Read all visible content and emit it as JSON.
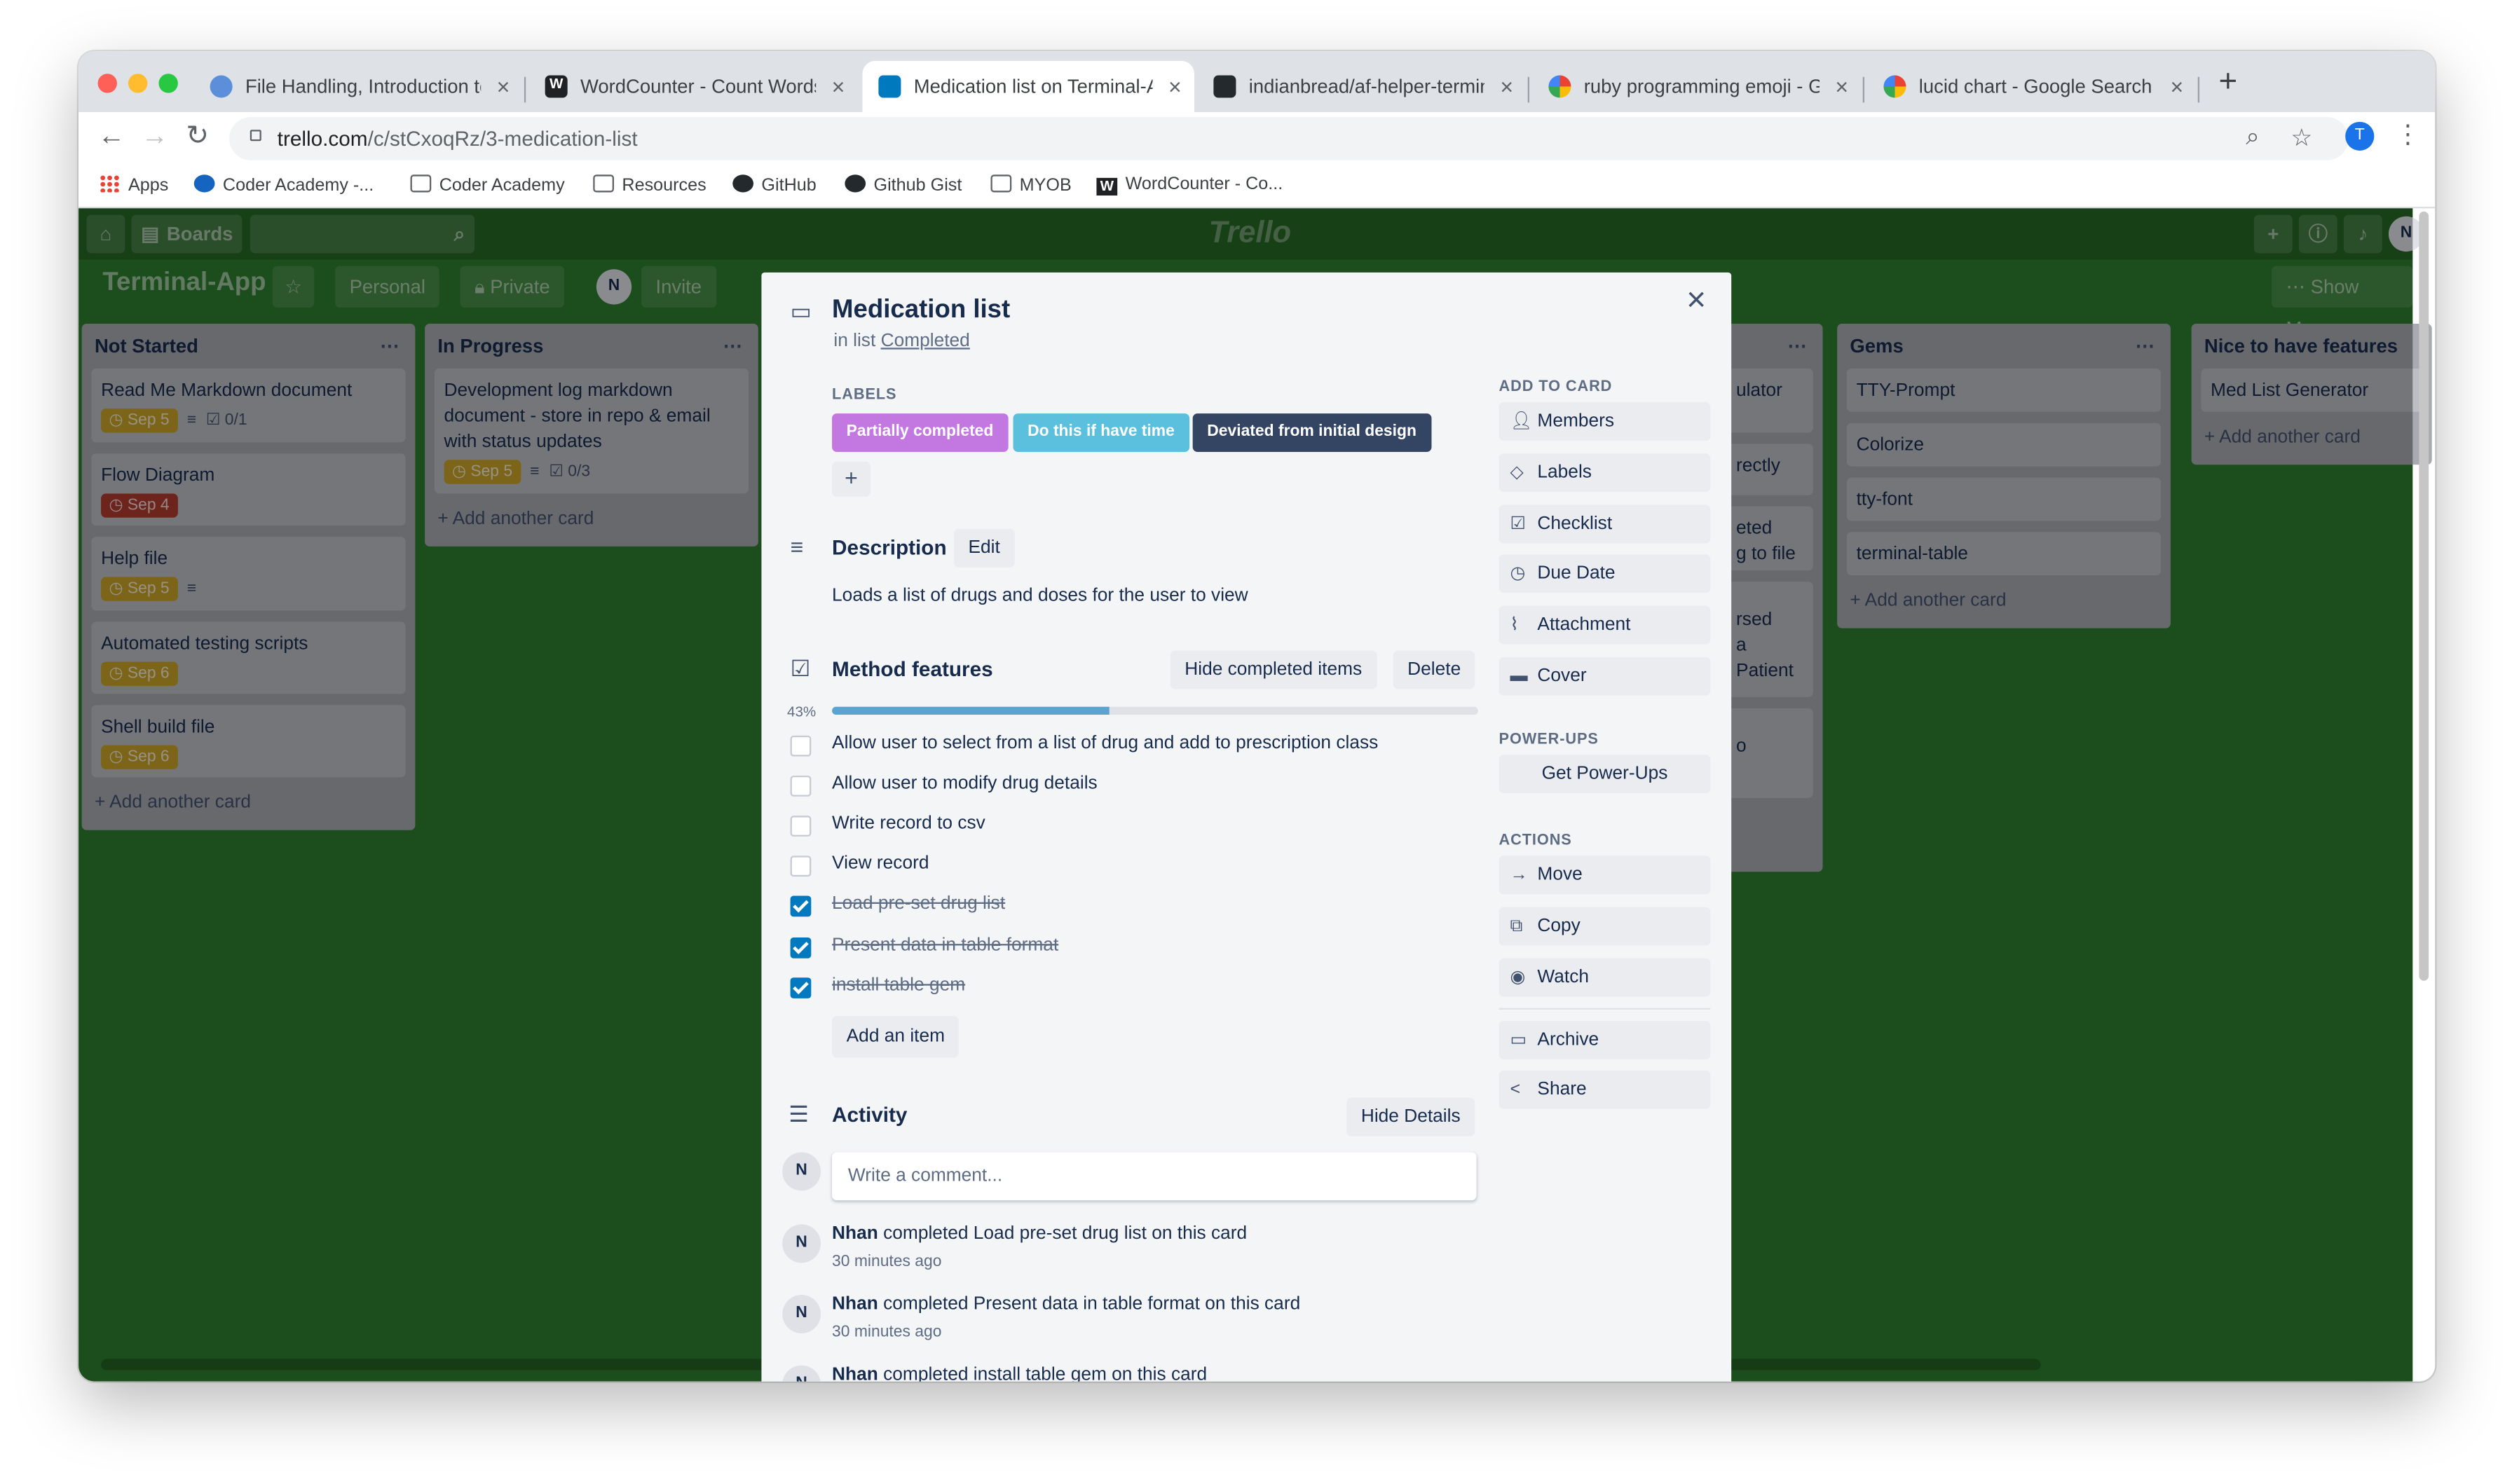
{
  "browser": {
    "tabs": [
      {
        "title": "File Handling, Introduction to T",
        "favicon_color": "#5b8fd9"
      },
      {
        "title": "WordCounter - Count Words &",
        "favicon_color": "#202124"
      },
      {
        "title": "Medication list on Terminal-Ap",
        "favicon_color": "#0079bf"
      },
      {
        "title": "indianbread/af-helper-terminal",
        "favicon_color": "#24292e"
      },
      {
        "title": "ruby programming emoji - Goo",
        "favicon_color": "#4285f4"
      },
      {
        "title": "lucid chart - Google Search",
        "favicon_color": "#4285f4"
      }
    ],
    "url_host": "trello.com",
    "url_path": "/c/stCxoqRz/3-medication-list",
    "profile_initial": "T",
    "bookmarks": [
      "Apps",
      "Coder Academy -...",
      "Coder Academy",
      "Resources",
      "GitHub",
      "Github Gist",
      "MYOB",
      "WordCounter - Co..."
    ]
  },
  "board": {
    "boards_label": "Boards",
    "logo": "Trello",
    "title": "Terminal-App",
    "personal_label": "Personal",
    "private_label": "Private",
    "member_initial": "N",
    "invite_label": "Invite",
    "show_menu_label": "Show Menu",
    "background_color": "#2e7d2e",
    "lists": [
      {
        "name": "Not Started",
        "cards": [
          {
            "title": "Read Me Markdown document",
            "due": "Sep 5",
            "checklist": "0/1"
          },
          {
            "title": "Flow Diagram",
            "due": "Sep 4"
          },
          {
            "title": "Help file",
            "due": "Sep 5"
          },
          {
            "title": "Automated testing scripts",
            "due": "Sep 6"
          },
          {
            "title": "Shell build file",
            "due": "Sep 6"
          }
        ],
        "add_label": "Add another card"
      },
      {
        "name": "In Progress",
        "cards": [
          {
            "title": "Development log markdown document - store in repo & email with status updates",
            "due": "Sep 5",
            "checklist": "0/3"
          }
        ],
        "add_label": "Add another card"
      },
      {
        "name": "Gems",
        "cards": [
          {
            "title": "TTY-Prompt"
          },
          {
            "title": "Colorize"
          },
          {
            "title": "tty-font"
          },
          {
            "title": "terminal-table"
          }
        ],
        "add_label": "Add another card"
      },
      {
        "name": "Nice to have features",
        "cards": [
          {
            "title": "Med List Generator"
          }
        ],
        "add_label": "Add another card"
      }
    ],
    "partial_fragments": [
      "ulator",
      "rectly",
      "eted",
      "g to file",
      "rsed",
      "a Patient",
      "o"
    ]
  },
  "modal": {
    "title": "Medication list",
    "in_list_prefix": "in list",
    "list_name": "Completed",
    "labels_heading": "LABELS",
    "labels": [
      {
        "text": "Partially completed",
        "color": "#c377e0"
      },
      {
        "text": "Do this if have time",
        "color": "#5bc0de"
      },
      {
        "text": "Deviated from initial design",
        "color": "#344563"
      }
    ],
    "description_heading": "Description",
    "edit_label": "Edit",
    "description": "Loads a list of drugs and doses for the user to view",
    "checklist": {
      "title": "Method features",
      "hide_label": "Hide completed items",
      "delete_label": "Delete",
      "progress_percent": 43,
      "progress_text": "43%",
      "items": [
        {
          "text": "Allow user to select from a list of drug and add to prescription class",
          "checked": false
        },
        {
          "text": "Allow user to modify drug details",
          "checked": false
        },
        {
          "text": "Write record to csv",
          "checked": false
        },
        {
          "text": "View record",
          "checked": false
        },
        {
          "text": "Load pre-set drug list",
          "checked": true
        },
        {
          "text": "Present data in table format",
          "checked": true
        },
        {
          "text": "install table gem",
          "checked": true
        }
      ],
      "add_item_label": "Add an item"
    },
    "activity": {
      "heading": "Activity",
      "hide_details_label": "Hide Details",
      "comment_placeholder": "Write a comment...",
      "user_initial": "N",
      "entries": [
        {
          "user": "Nhan",
          "text": "completed Load pre-set drug list on this card",
          "time": "30 minutes ago"
        },
        {
          "user": "Nhan",
          "text": "completed Present data in table format on this card",
          "time": "30 minutes ago"
        },
        {
          "user": "Nhan",
          "text": "completed install table gem on this card",
          "time": ""
        }
      ]
    },
    "add_to_card_heading": "ADD TO CARD",
    "add_to_card": [
      "Members",
      "Labels",
      "Checklist",
      "Due Date",
      "Attachment",
      "Cover"
    ],
    "powerups_heading": "POWER-UPS",
    "get_powerups_label": "Get Power-Ups",
    "actions_heading": "ACTIONS",
    "actions": [
      "Move",
      "Copy",
      "Watch",
      "Archive",
      "Share"
    ]
  }
}
